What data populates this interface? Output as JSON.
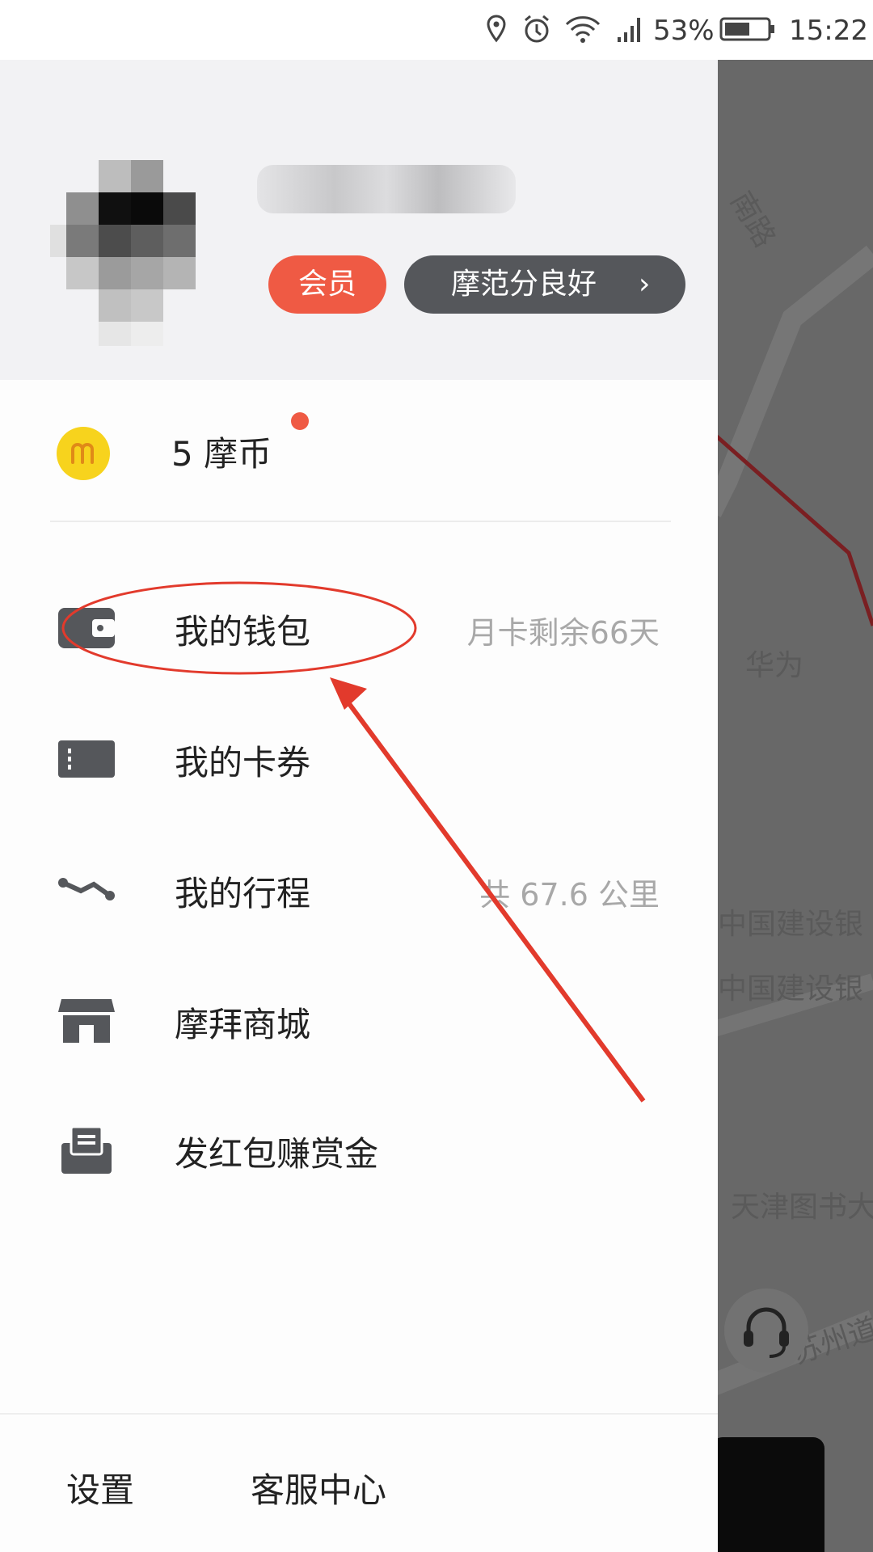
{
  "status_bar": {
    "battery_percent": "53%",
    "time": "15:22",
    "icons": [
      "location-icon",
      "alarm-icon",
      "wifi-icon",
      "signal-icon",
      "battery-icon"
    ]
  },
  "drawer": {
    "profile": {
      "member_badge": "会员",
      "credit_badge": "摩范分良好",
      "credit_chevron": "›"
    },
    "coins": {
      "label": "5 摩币",
      "has_notification_dot": true
    },
    "menu": [
      {
        "label": "我的钱包",
        "value": "月卡剩余66天",
        "icon": "wallet-icon"
      },
      {
        "label": "我的卡券",
        "value": "",
        "icon": "ticket-icon"
      },
      {
        "label": "我的行程",
        "value": "共 67.6 公里",
        "icon": "trip-icon"
      },
      {
        "label": "摩拜商城",
        "value": "",
        "icon": "store-icon"
      },
      {
        "label": "发红包赚赏金",
        "value": "",
        "icon": "red-envelope-icon"
      }
    ],
    "footer": {
      "settings": "设置",
      "support": "客服中心"
    }
  },
  "map": {
    "labels": [
      "南路",
      "华为",
      "中国建设银",
      "中国建设银",
      "天津图书大",
      "苏州道"
    ]
  },
  "colors": {
    "accent": "#ef5a44",
    "coin": "#f7d31d",
    "badge_dark": "#55575b"
  }
}
